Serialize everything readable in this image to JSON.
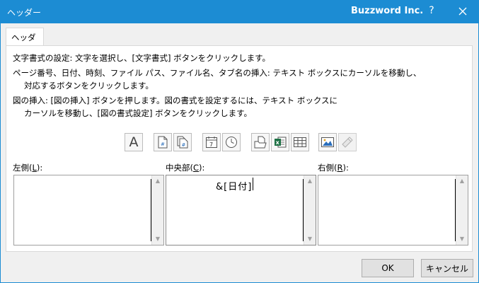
{
  "window": {
    "title": "ヘッダー",
    "brand": "Buzzword Inc.",
    "help_label": "?",
    "accent_color": "#1c8cd3"
  },
  "tab": {
    "label": "ヘッダー"
  },
  "instructions": [
    "文字書式の設定: 文字を選択し、[文字書式] ボタンをクリックします。",
    "ページ番号、日付、時刻、ファイル パス、ファイル名、タブ名の挿入: テキスト ボックスにカーソルを移動し、",
    "対応するボタンをクリックします。",
    "図の挿入: [図の挿入] ボタンを押します。図の書式を設定するには、テキスト ボックスに",
    "カーソルを移動し、[図の書式設定] ボタンをクリックします。"
  ],
  "toolbar_icons": [
    "format-text-icon",
    "page-number-icon",
    "number-of-pages-icon",
    "current-date-icon",
    "current-time-icon",
    "file-path-icon",
    "file-name-icon",
    "sheet-name-icon",
    "insert-picture-icon",
    "format-picture-icon"
  ],
  "toolbar": {
    "format_text_glyph": "A",
    "date_glyph": "7"
  },
  "sections": {
    "left": {
      "label_pre": "左側(",
      "label_key": "L",
      "label_post": "):",
      "value": ""
    },
    "center": {
      "label_pre": "中央部(",
      "label_key": "C",
      "label_post": "):",
      "value": "&[日付]"
    },
    "right": {
      "label_pre": "右側(",
      "label_key": "R",
      "label_post": "):",
      "value": ""
    }
  },
  "buttons": {
    "ok": "OK",
    "cancel": "キャンセル"
  }
}
